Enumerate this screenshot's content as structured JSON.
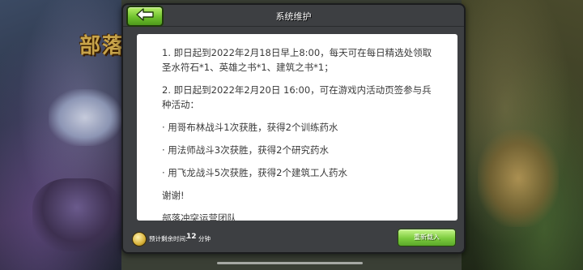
{
  "background": {
    "title": "部落"
  },
  "dialog": {
    "title": "系统维护",
    "paragraphs": [
      "1. 即日起到2022年2月18日早上8:00，每天可在每日精选处领取圣水符石*1、英雄之书*1、建筑之书*1；",
      "2. 即日起到2022年2月20日 16:00，可在游戏内活动页签参与兵种活动：",
      "· 用哥布林战斗1次获胜，获得2个训练药水",
      "· 用法师战斗3次获胜，获得2个研究药水",
      "· 用飞龙战斗5次获胜，获得2个建筑工人药水",
      "谢谢!",
      "部落冲突运营团队"
    ],
    "footer": {
      "timer_label": "预计剩余时间:",
      "timer_value": "12",
      "timer_unit": "分钟",
      "reload_label": "重新载入"
    }
  },
  "colors": {
    "button_green": "#7ccc3e",
    "dialog_bg": "#3d3f42",
    "content_bg": "#ffffff"
  },
  "icons": {
    "back": "back-arrow-icon",
    "timer": "timer-icon"
  }
}
